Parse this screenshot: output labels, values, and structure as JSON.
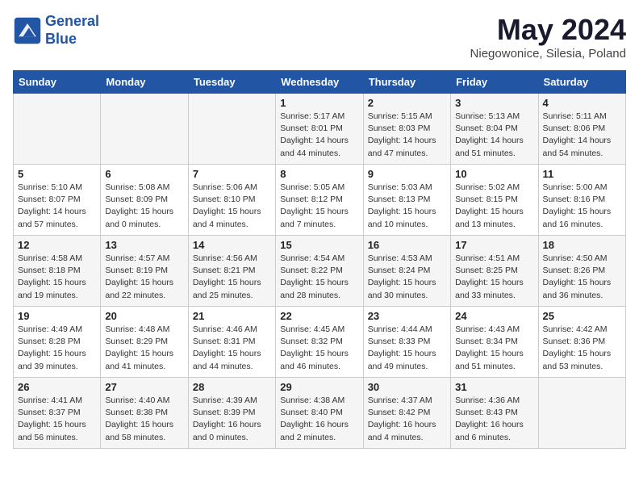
{
  "header": {
    "logo_line1": "General",
    "logo_line2": "Blue",
    "month_title": "May 2024",
    "location": "Niegowonice, Silesia, Poland"
  },
  "weekdays": [
    "Sunday",
    "Monday",
    "Tuesday",
    "Wednesday",
    "Thursday",
    "Friday",
    "Saturday"
  ],
  "weeks": [
    [
      {
        "day": "",
        "info": ""
      },
      {
        "day": "",
        "info": ""
      },
      {
        "day": "",
        "info": ""
      },
      {
        "day": "1",
        "info": "Sunrise: 5:17 AM\nSunset: 8:01 PM\nDaylight: 14 hours\nand 44 minutes."
      },
      {
        "day": "2",
        "info": "Sunrise: 5:15 AM\nSunset: 8:03 PM\nDaylight: 14 hours\nand 47 minutes."
      },
      {
        "day": "3",
        "info": "Sunrise: 5:13 AM\nSunset: 8:04 PM\nDaylight: 14 hours\nand 51 minutes."
      },
      {
        "day": "4",
        "info": "Sunrise: 5:11 AM\nSunset: 8:06 PM\nDaylight: 14 hours\nand 54 minutes."
      }
    ],
    [
      {
        "day": "5",
        "info": "Sunrise: 5:10 AM\nSunset: 8:07 PM\nDaylight: 14 hours\nand 57 minutes."
      },
      {
        "day": "6",
        "info": "Sunrise: 5:08 AM\nSunset: 8:09 PM\nDaylight: 15 hours\nand 0 minutes."
      },
      {
        "day": "7",
        "info": "Sunrise: 5:06 AM\nSunset: 8:10 PM\nDaylight: 15 hours\nand 4 minutes."
      },
      {
        "day": "8",
        "info": "Sunrise: 5:05 AM\nSunset: 8:12 PM\nDaylight: 15 hours\nand 7 minutes."
      },
      {
        "day": "9",
        "info": "Sunrise: 5:03 AM\nSunset: 8:13 PM\nDaylight: 15 hours\nand 10 minutes."
      },
      {
        "day": "10",
        "info": "Sunrise: 5:02 AM\nSunset: 8:15 PM\nDaylight: 15 hours\nand 13 minutes."
      },
      {
        "day": "11",
        "info": "Sunrise: 5:00 AM\nSunset: 8:16 PM\nDaylight: 15 hours\nand 16 minutes."
      }
    ],
    [
      {
        "day": "12",
        "info": "Sunrise: 4:58 AM\nSunset: 8:18 PM\nDaylight: 15 hours\nand 19 minutes."
      },
      {
        "day": "13",
        "info": "Sunrise: 4:57 AM\nSunset: 8:19 PM\nDaylight: 15 hours\nand 22 minutes."
      },
      {
        "day": "14",
        "info": "Sunrise: 4:56 AM\nSunset: 8:21 PM\nDaylight: 15 hours\nand 25 minutes."
      },
      {
        "day": "15",
        "info": "Sunrise: 4:54 AM\nSunset: 8:22 PM\nDaylight: 15 hours\nand 28 minutes."
      },
      {
        "day": "16",
        "info": "Sunrise: 4:53 AM\nSunset: 8:24 PM\nDaylight: 15 hours\nand 30 minutes."
      },
      {
        "day": "17",
        "info": "Sunrise: 4:51 AM\nSunset: 8:25 PM\nDaylight: 15 hours\nand 33 minutes."
      },
      {
        "day": "18",
        "info": "Sunrise: 4:50 AM\nSunset: 8:26 PM\nDaylight: 15 hours\nand 36 minutes."
      }
    ],
    [
      {
        "day": "19",
        "info": "Sunrise: 4:49 AM\nSunset: 8:28 PM\nDaylight: 15 hours\nand 39 minutes."
      },
      {
        "day": "20",
        "info": "Sunrise: 4:48 AM\nSunset: 8:29 PM\nDaylight: 15 hours\nand 41 minutes."
      },
      {
        "day": "21",
        "info": "Sunrise: 4:46 AM\nSunset: 8:31 PM\nDaylight: 15 hours\nand 44 minutes."
      },
      {
        "day": "22",
        "info": "Sunrise: 4:45 AM\nSunset: 8:32 PM\nDaylight: 15 hours\nand 46 minutes."
      },
      {
        "day": "23",
        "info": "Sunrise: 4:44 AM\nSunset: 8:33 PM\nDaylight: 15 hours\nand 49 minutes."
      },
      {
        "day": "24",
        "info": "Sunrise: 4:43 AM\nSunset: 8:34 PM\nDaylight: 15 hours\nand 51 minutes."
      },
      {
        "day": "25",
        "info": "Sunrise: 4:42 AM\nSunset: 8:36 PM\nDaylight: 15 hours\nand 53 minutes."
      }
    ],
    [
      {
        "day": "26",
        "info": "Sunrise: 4:41 AM\nSunset: 8:37 PM\nDaylight: 15 hours\nand 56 minutes."
      },
      {
        "day": "27",
        "info": "Sunrise: 4:40 AM\nSunset: 8:38 PM\nDaylight: 15 hours\nand 58 minutes."
      },
      {
        "day": "28",
        "info": "Sunrise: 4:39 AM\nSunset: 8:39 PM\nDaylight: 16 hours\nand 0 minutes."
      },
      {
        "day": "29",
        "info": "Sunrise: 4:38 AM\nSunset: 8:40 PM\nDaylight: 16 hours\nand 2 minutes."
      },
      {
        "day": "30",
        "info": "Sunrise: 4:37 AM\nSunset: 8:42 PM\nDaylight: 16 hours\nand 4 minutes."
      },
      {
        "day": "31",
        "info": "Sunrise: 4:36 AM\nSunset: 8:43 PM\nDaylight: 16 hours\nand 6 minutes."
      },
      {
        "day": "",
        "info": ""
      }
    ]
  ]
}
